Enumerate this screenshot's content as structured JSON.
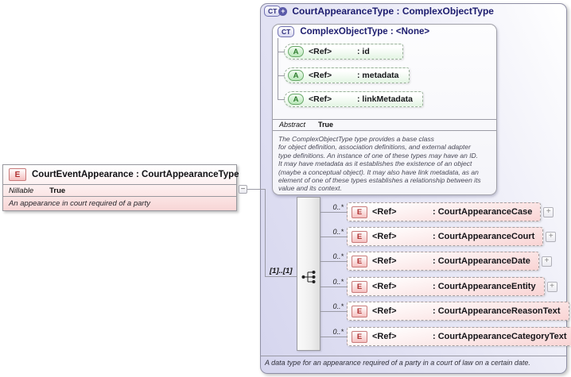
{
  "icons": {
    "element": "E",
    "attribute": "A",
    "complex_type": "CT",
    "ct_plus": "+",
    "collapse": "−",
    "expand": "+"
  },
  "colors": {
    "container_lavender": "#d8d8f0",
    "element_pink": "#f9d4d4",
    "attribute_green": "#e3f5e3",
    "header_navy": "#1c1c6e"
  },
  "left_box": {
    "title": "CourtEventAppearance : CourtAppearanceType",
    "property_label": "Nillable",
    "property_value": "True",
    "description": "An appearance in court required of a party"
  },
  "container": {
    "title": "CourtAppearanceType : ComplexObjectType",
    "footer": "A data type for an appearance required of a party in a court of law on a certain date.",
    "base_type": {
      "title": "ComplexObjectType : <None>",
      "attributes": [
        {
          "ref": "<Ref>",
          "name": ": id"
        },
        {
          "ref": "<Ref>",
          "name": ": metadata"
        },
        {
          "ref": "<Ref>",
          "name": ": linkMetadata"
        }
      ],
      "property_label": "Abstract",
      "property_value": "True",
      "description": "The ComplexObjectType type provides a base class\nfor object definition, association definitions, and external adapter\ntype definitions. An instance of one of these types may have an ID.\nIt may have metadata as it establishes the existence of an object\n(maybe a conceptual object). It may also have link metadata, as an\nelement of one of these types establishes a relationship between its\nvalue and its context."
    },
    "sequence": {
      "cardinality": "[1]..[1]"
    },
    "elements": [
      {
        "ref": "<Ref>",
        "name": ": CourtAppearanceCase",
        "occurrence": "0..*"
      },
      {
        "ref": "<Ref>",
        "name": ": CourtAppearanceCourt",
        "occurrence": "0..*"
      },
      {
        "ref": "<Ref>",
        "name": ": CourtAppearanceDate",
        "occurrence": "0..*"
      },
      {
        "ref": "<Ref>",
        "name": ": CourtAppearanceEntity",
        "occurrence": "0..*"
      },
      {
        "ref": "<Ref>",
        "name": ": CourtAppearanceReasonText",
        "occurrence": "0..*"
      },
      {
        "ref": "<Ref>",
        "name": ": CourtAppearanceCategoryText",
        "occurrence": "0..*"
      }
    ]
  }
}
